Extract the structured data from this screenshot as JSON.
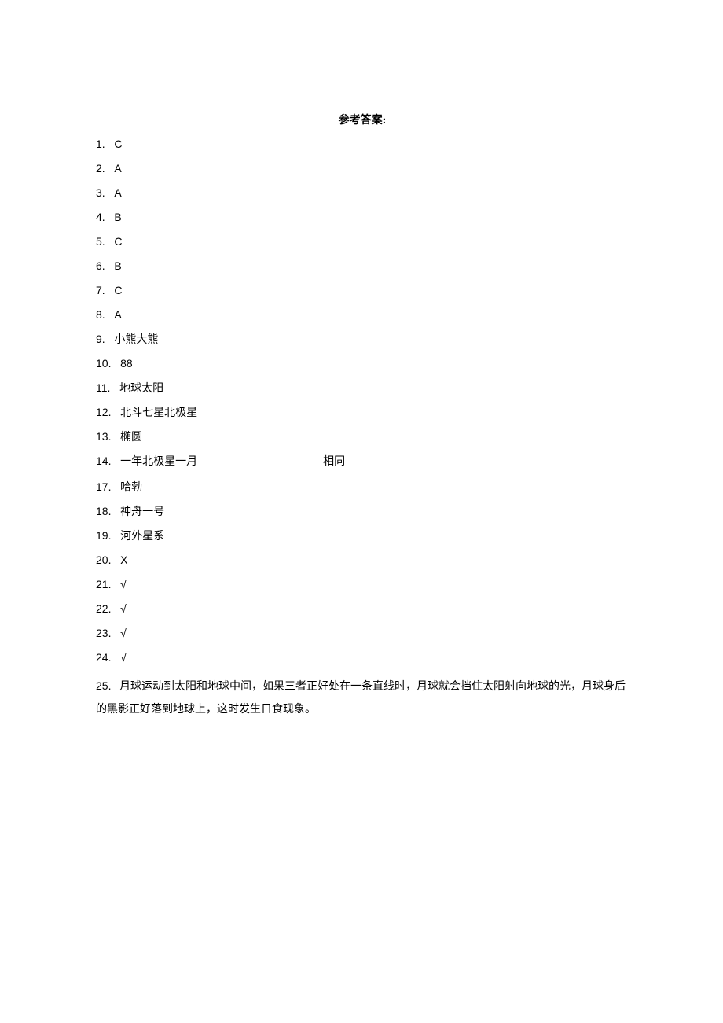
{
  "title": "参考答案:",
  "answers": {
    "a1": {
      "num": "1.",
      "val": "C"
    },
    "a2": {
      "num": "2.",
      "val": "A"
    },
    "a3": {
      "num": "3.",
      "val": "A"
    },
    "a4": {
      "num": "4.",
      "val": "B"
    },
    "a5": {
      "num": "5.",
      "val": "C"
    },
    "a6": {
      "num": "6.",
      "val": "B"
    },
    "a7": {
      "num": "7.",
      "val": "C"
    },
    "a8": {
      "num": "8.",
      "val": "A"
    },
    "a9": {
      "num": "9.",
      "val": "小熊大熊"
    },
    "a10": {
      "num": "10.",
      "val": "88"
    },
    "a11": {
      "num": "11.",
      "val": "地球太阳"
    },
    "a12": {
      "num": "12.",
      "val": "北斗七星北极星"
    },
    "a13": {
      "num": "13.",
      "val": "椭圆"
    },
    "a14": {
      "num": "14.",
      "val": "一年北极星一月",
      "extra": "相同"
    },
    "a17": {
      "num": "17.",
      "val": "哈勃"
    },
    "a18": {
      "num": "18.",
      "val": "神舟一号"
    },
    "a19": {
      "num": "19.",
      "val": "河外星系"
    },
    "a20": {
      "num": "20.",
      "val": "X"
    },
    "a21": {
      "num": "21.",
      "val": "√"
    },
    "a22": {
      "num": "22.",
      "val": "√"
    },
    "a23": {
      "num": "23.",
      "val": "√"
    },
    "a24": {
      "num": "24.",
      "val": "√"
    },
    "a25": {
      "num": "25.",
      "val": "月球运动到太阳和地球中间，如果三者正好处在一条直线时，月球就会挡住太阳射向地球的光，月球身后的黑影正好落到地球上，这时发生日食现象。"
    }
  }
}
